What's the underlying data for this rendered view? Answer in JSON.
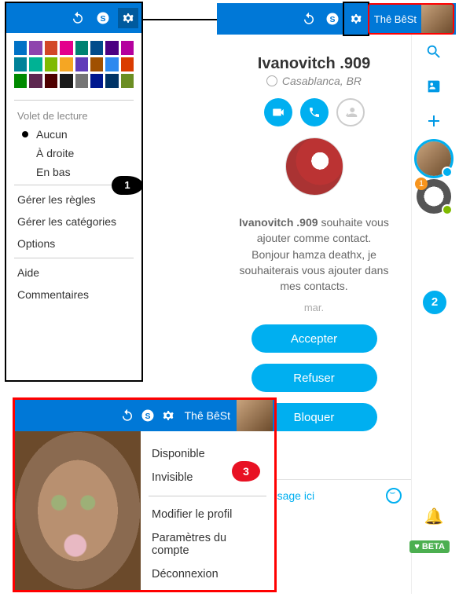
{
  "panel1": {
    "swatches": [
      [
        "#0072c6",
        "#8e44ad",
        "#d24726",
        "#e3008c",
        "#008272",
        "#004b8b",
        "#4b0082",
        "#b4009e"
      ],
      [
        "#008299",
        "#00b294",
        "#7fba00",
        "#f5a623",
        "#603cba",
        "#a05000",
        "#2d89ef",
        "#da3b01"
      ],
      [
        "#008a00",
        "#5e2750",
        "#4e0000",
        "#1b1b1b",
        "#767676",
        "#00188f",
        "#003366",
        "#6b8e23"
      ]
    ],
    "reading_pane_label": "Volet de lecture",
    "reading_pane": {
      "none": "Aucun",
      "right": "À droite",
      "bottom": "En bas"
    },
    "manage_rules": "Gérer les règles",
    "manage_categories": "Gérer les catégories",
    "options": "Options",
    "help": "Aide",
    "feedback": "Commentaires"
  },
  "panel2": {
    "username": "Thê BêSt",
    "contact_name": "Ivanovitch .909",
    "contact_location": "Casablanca, BR",
    "request_line1": "Ivanovitch .909 souhaite vous ajouter comme contact.",
    "request_line2": "Bonjour hamza deathx, je souhaiterais vous ajouter dans mes contacts.",
    "request_day": "mar.",
    "accept": "Accepter",
    "refuse": "Refuser",
    "block": "Bloquer",
    "composer_placeholder": "ez un message ici",
    "rail_badge": "1",
    "beta_label": "BETA"
  },
  "panel3": {
    "username": "Thê BêSt",
    "status_available": "Disponible",
    "status_invisible": "Invisible",
    "edit_profile": "Modifier le profil",
    "account_settings": "Paramètres du compte",
    "logout": "Déconnexion"
  },
  "callouts": {
    "one": "1",
    "two": "2",
    "three": "3"
  }
}
